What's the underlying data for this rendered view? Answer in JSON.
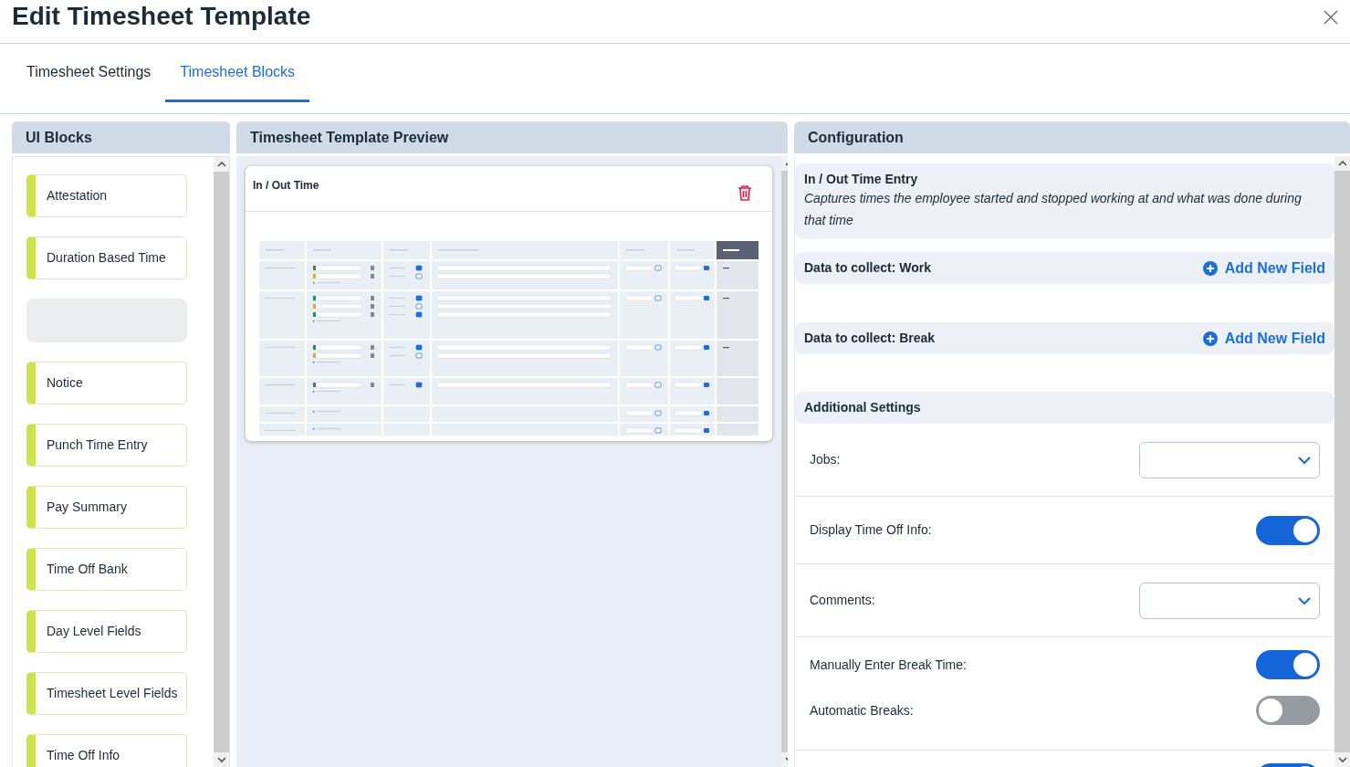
{
  "window": {
    "title": "Edit Timesheet Template"
  },
  "tabs": [
    {
      "label": "Timesheet Settings",
      "selected": false
    },
    {
      "label": "Timesheet Blocks",
      "selected": true
    }
  ],
  "ui_blocks": {
    "title": "UI Blocks",
    "items": [
      {
        "kind": "block",
        "label": "Attestation"
      },
      {
        "kind": "block",
        "label": "Duration Based Time"
      },
      {
        "kind": "placeholder"
      },
      {
        "kind": "block",
        "label": "Notice"
      },
      {
        "kind": "block",
        "label": "Punch Time Entry"
      },
      {
        "kind": "block",
        "label": "Pay Summary"
      },
      {
        "kind": "block",
        "label": "Time Off Bank"
      },
      {
        "kind": "block",
        "label": "Day Level Fields"
      },
      {
        "kind": "block",
        "label": "Timesheet Level Fields"
      },
      {
        "kind": "block",
        "label": "Time Off Info"
      }
    ]
  },
  "preview": {
    "title": "Timesheet Template Preview",
    "card": {
      "title": "In / Out Time"
    }
  },
  "configuration": {
    "title": "Configuration",
    "block": {
      "name": "In / Out Time Entry",
      "description": "Captures times the employee started and stopped working at and what was done during that time"
    },
    "collect_sections": [
      {
        "label": "Data to collect: Work",
        "action": "Add New Field"
      },
      {
        "label": "Data to collect: Break",
        "action": "Add New Field"
      }
    ],
    "additional_settings": {
      "title": "Additional Settings",
      "groups": [
        [
          {
            "kind": "select",
            "label": "Jobs:"
          }
        ],
        [
          {
            "kind": "toggle",
            "label": "Display Time Off Info:",
            "on": true
          }
        ],
        [
          {
            "kind": "select",
            "label": "Comments:"
          }
        ],
        [
          {
            "kind": "toggle",
            "label": "Manually Enter Break Time:",
            "on": true
          },
          {
            "kind": "toggle",
            "label": "Automatic Breaks:",
            "on": false
          }
        ],
        [
          {
            "kind": "toggle",
            "on": true
          }
        ]
      ]
    }
  }
}
